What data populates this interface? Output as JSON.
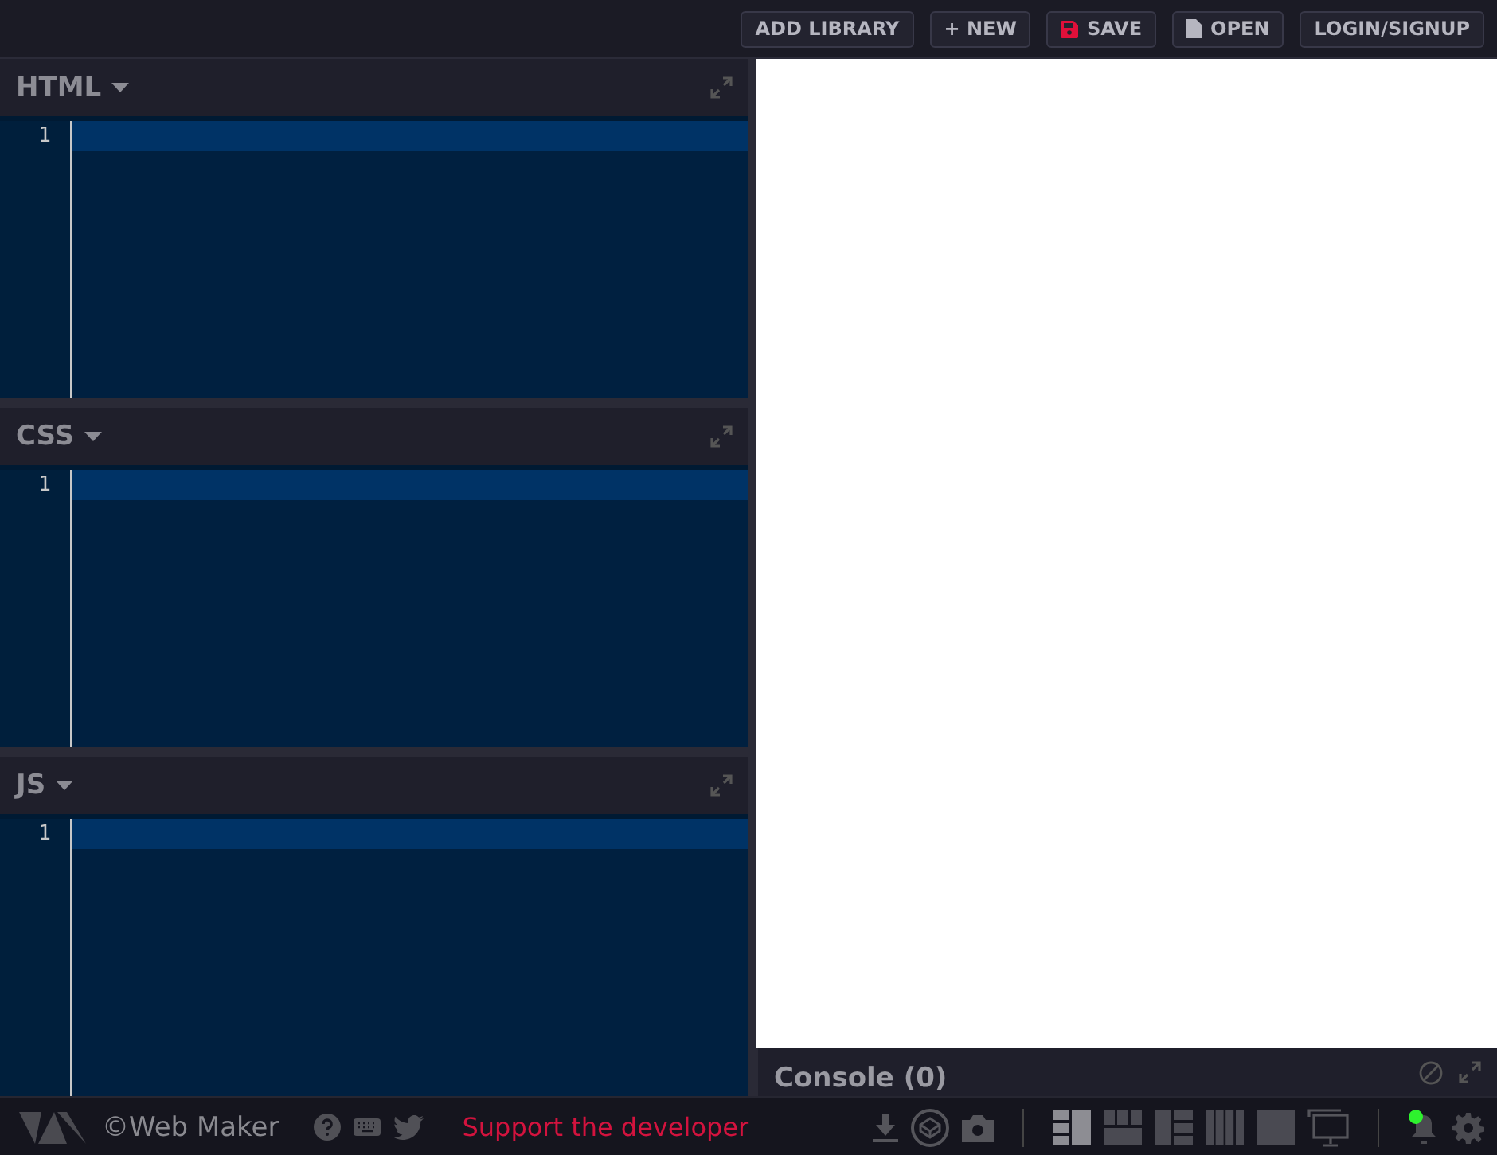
{
  "toolbar": {
    "buttons": [
      {
        "label": "ADD LIBRARY",
        "kind": "plain"
      },
      {
        "label": "+ NEW",
        "kind": "plain"
      },
      {
        "label": "SAVE",
        "kind": "save"
      },
      {
        "label": "OPEN",
        "kind": "open"
      },
      {
        "label": "LOGIN/SIGNUP",
        "kind": "plain"
      }
    ]
  },
  "editors": [
    {
      "title": "HTML",
      "lines": [
        "1"
      ]
    },
    {
      "title": "CSS",
      "lines": [
        "1"
      ]
    },
    {
      "title": "JS",
      "lines": [
        "1"
      ]
    }
  ],
  "console": {
    "title": "Console (0)"
  },
  "footer": {
    "brand": "©Web Maker",
    "support_link": "Support the developer",
    "layouts": [
      {
        "kind": "left",
        "selected": true
      },
      {
        "kind": "top",
        "selected": false
      },
      {
        "kind": "right",
        "selected": false
      },
      {
        "kind": "columns",
        "selected": false
      },
      {
        "kind": "full",
        "selected": false
      }
    ],
    "notifications": {
      "has_new": true
    }
  }
}
